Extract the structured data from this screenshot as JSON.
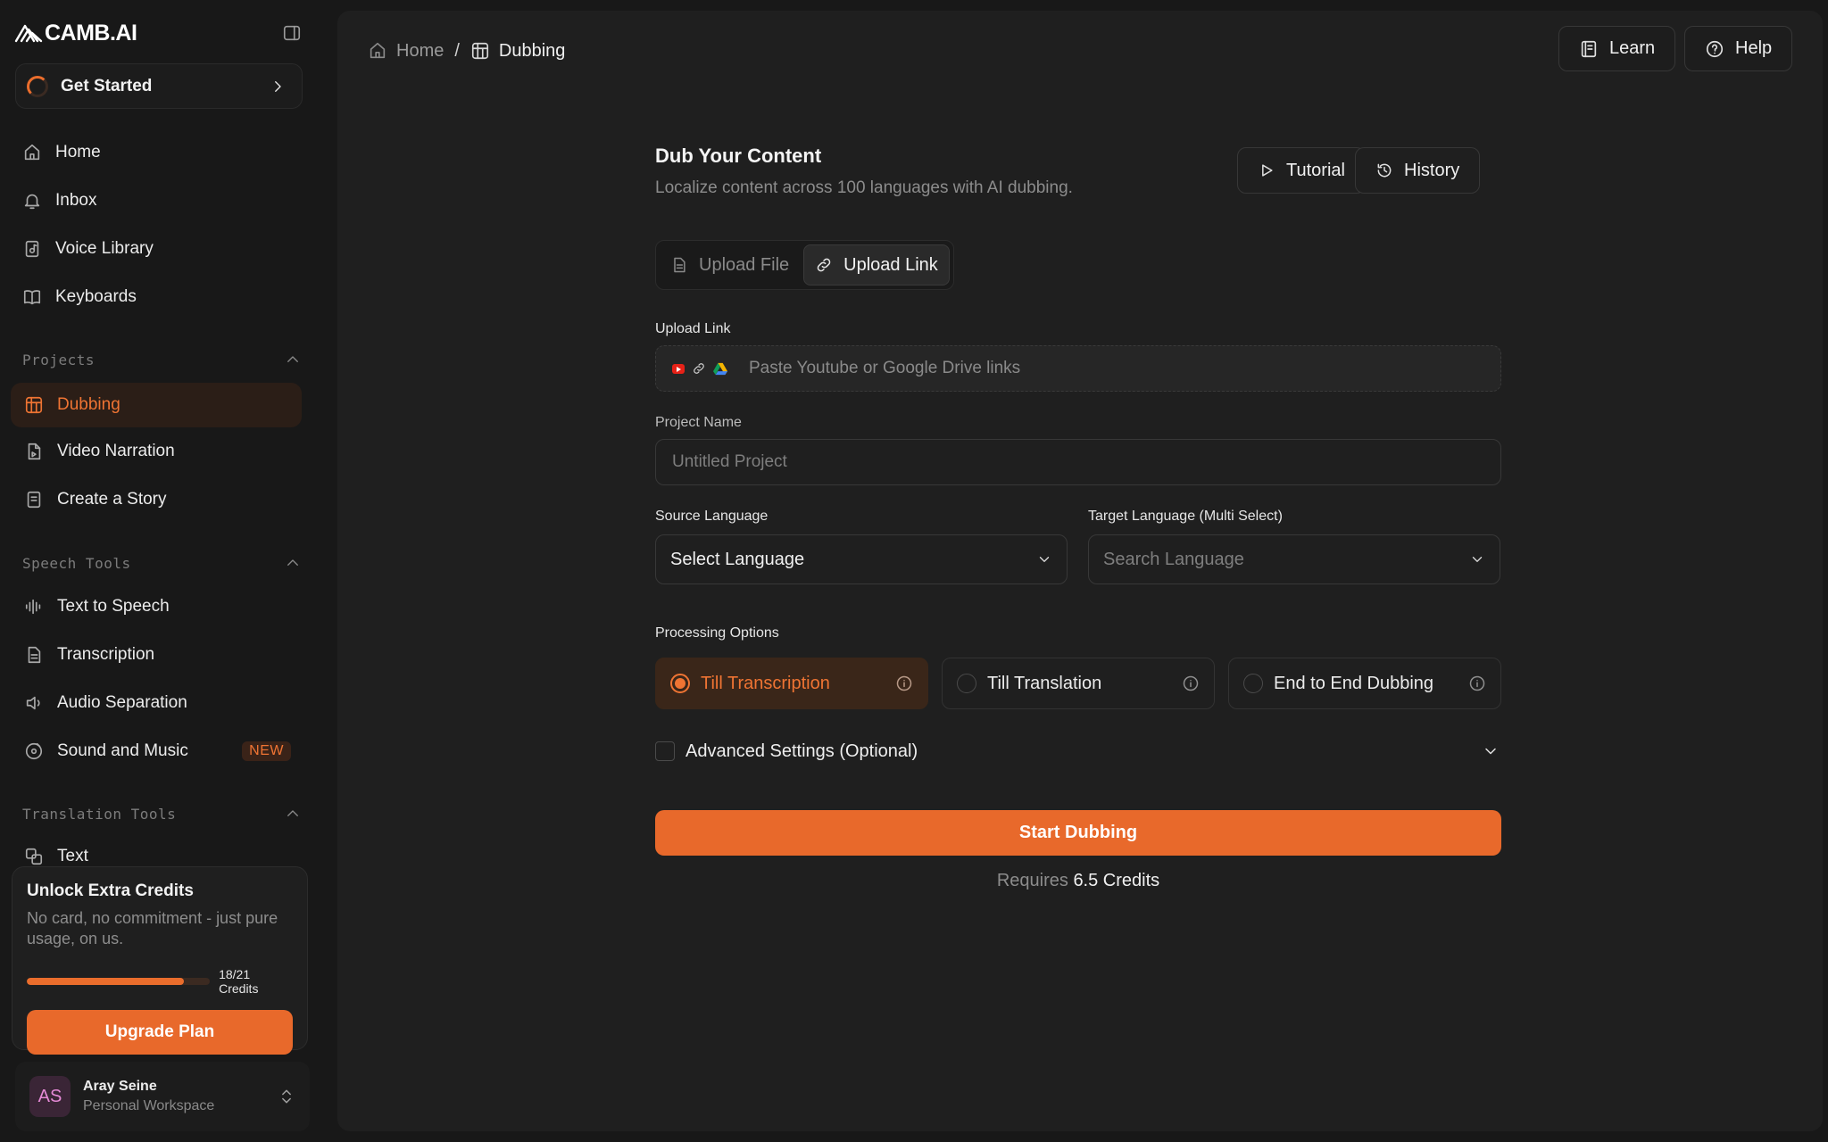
{
  "brand": {
    "name": "CAMB.AI"
  },
  "sidebar": {
    "get_started": "Get Started",
    "nav": [
      {
        "label": "Home",
        "icon": "home-icon"
      },
      {
        "label": "Inbox",
        "icon": "bell-icon"
      },
      {
        "label": "Voice Library",
        "icon": "voice-library-icon"
      },
      {
        "label": "Keyboards",
        "icon": "book-icon"
      }
    ],
    "sections": {
      "projects": {
        "title": "Projects",
        "items": [
          {
            "label": "Dubbing",
            "icon": "dubbing-icon",
            "active": true
          },
          {
            "label": "Video Narration",
            "icon": "video-file-icon"
          },
          {
            "label": "Create a Story",
            "icon": "story-book-icon"
          }
        ]
      },
      "speech_tools": {
        "title": "Speech Tools",
        "items": [
          {
            "label": "Text to Speech",
            "icon": "waveform-icon"
          },
          {
            "label": "Transcription",
            "icon": "document-icon"
          },
          {
            "label": "Audio Separation",
            "icon": "speaker-icon"
          },
          {
            "label": "Sound and Music",
            "icon": "music-disc-icon",
            "badge": "NEW"
          }
        ]
      },
      "translation_tools": {
        "title": "Translation Tools",
        "items": [
          {
            "label": "Text",
            "icon": "translate-icon"
          }
        ]
      }
    },
    "credits_card": {
      "title": "Unlock Extra Credits",
      "description": "No card, no commitment - just pure usage, on us.",
      "progress_text": "18/21 Credits",
      "progress_fraction": 0.857,
      "upgrade_label": "Upgrade Plan"
    },
    "user": {
      "initials": "AS",
      "name": "Aray Seine",
      "workspace": "Personal Workspace"
    }
  },
  "header": {
    "breadcrumb": {
      "home": "Home",
      "separator": "/",
      "current": "Dubbing"
    },
    "learn_label": "Learn",
    "help_label": "Help"
  },
  "main": {
    "title": "Dub Your Content",
    "subtitle": "Localize content across 100 languages with AI dubbing.",
    "tutorial_label": "Tutorial",
    "history_label": "History",
    "tabs": [
      {
        "label": "Upload File",
        "icon": "file-icon",
        "active": false
      },
      {
        "label": "Upload Link",
        "icon": "link-icon",
        "active": true
      }
    ],
    "upload_link": {
      "label": "Upload Link",
      "placeholder": "Paste Youtube or Google Drive links"
    },
    "project_name": {
      "label": "Project Name",
      "placeholder": "Untitled Project"
    },
    "source_language": {
      "label": "Source Language",
      "value": "Select Language"
    },
    "target_language": {
      "label": "Target Language (Multi Select)",
      "placeholder": "Search Language"
    },
    "processing": {
      "label": "Processing Options",
      "options": [
        {
          "label": "Till Transcription",
          "selected": true
        },
        {
          "label": "Till Translation",
          "selected": false
        },
        {
          "label": "End to End Dubbing",
          "selected": false
        }
      ]
    },
    "advanced_label": "Advanced Settings (Optional)",
    "start_label": "Start Dubbing",
    "requires_prefix": "Requires",
    "requires_credits": "6.5 Credits"
  },
  "colors": {
    "accent": "#e8692b",
    "accent_text": "#ef7433",
    "background": "#181818",
    "panel": "#1f1f1f"
  }
}
